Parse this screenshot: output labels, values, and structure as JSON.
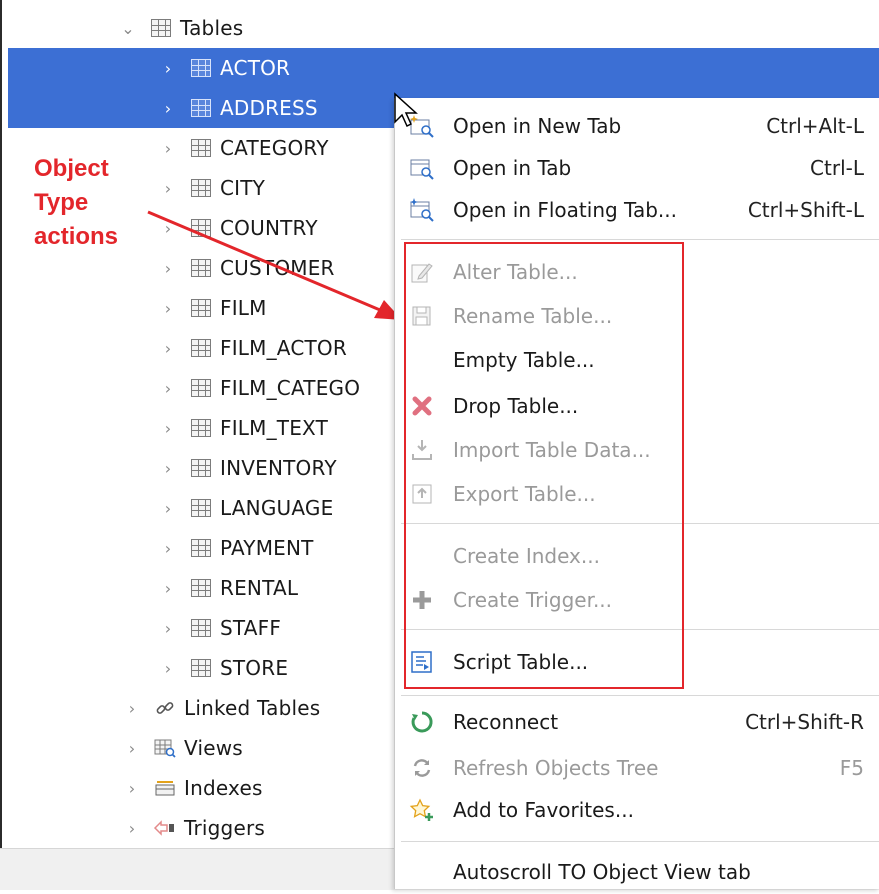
{
  "tree": {
    "tables_node": {
      "label": "Tables",
      "expander": "expanded",
      "icon": "table-icon"
    },
    "tables": [
      {
        "label": "ACTOR",
        "selected": true
      },
      {
        "label": "ADDRESS",
        "selected": true
      },
      {
        "label": "CATEGORY",
        "selected": false
      },
      {
        "label": "CITY",
        "selected": false
      },
      {
        "label": "COUNTRY",
        "selected": false
      },
      {
        "label": "CUSTOMER",
        "selected": false
      },
      {
        "label": "FILM",
        "selected": false
      },
      {
        "label": "FILM_ACTOR",
        "selected": false
      },
      {
        "label": "FILM_CATEGO",
        "selected": false
      },
      {
        "label": "FILM_TEXT",
        "selected": false
      },
      {
        "label": "INVENTORY",
        "selected": false
      },
      {
        "label": "LANGUAGE",
        "selected": false
      },
      {
        "label": "PAYMENT",
        "selected": false
      },
      {
        "label": "RENTAL",
        "selected": false
      },
      {
        "label": "STAFF",
        "selected": false
      },
      {
        "label": "STORE",
        "selected": false
      }
    ],
    "other_nodes": [
      {
        "label": "Linked Tables",
        "icon": "link-icon"
      },
      {
        "label": "Views",
        "icon": "view-icon"
      },
      {
        "label": "Indexes",
        "icon": "index-icon"
      },
      {
        "label": "Triggers",
        "icon": "trigger-icon"
      }
    ]
  },
  "annotation": {
    "line1": "Object",
    "line2": "Type",
    "line3": "actions",
    "color": "#e3262b"
  },
  "context_menu": {
    "items": [
      {
        "label": "Open in New Tab",
        "shortcut": "Ctrl+Alt-L",
        "icon": "open-new-tab-icon",
        "enabled": true
      },
      {
        "label": "Open in Tab",
        "shortcut": "Ctrl-L",
        "icon": "open-tab-icon",
        "enabled": true
      },
      {
        "label": "Open in Floating Tab...",
        "shortcut": "Ctrl+Shift-L",
        "icon": "open-floating-tab-icon",
        "enabled": true
      },
      {
        "label": "Alter Table...",
        "shortcut": "",
        "icon": "edit-icon",
        "enabled": false
      },
      {
        "label": "Rename Table...",
        "shortcut": "",
        "icon": "rename-icon",
        "enabled": false
      },
      {
        "label": "Empty Table...",
        "shortcut": "",
        "icon": "",
        "enabled": true
      },
      {
        "label": "Drop Table...",
        "shortcut": "",
        "icon": "drop-x-icon",
        "enabled": true
      },
      {
        "label": "Import Table Data...",
        "shortcut": "",
        "icon": "import-icon",
        "enabled": false
      },
      {
        "label": "Export Table...",
        "shortcut": "",
        "icon": "export-icon",
        "enabled": false
      },
      {
        "label": "Create Index...",
        "shortcut": "",
        "icon": "",
        "enabled": false
      },
      {
        "label": "Create Trigger...",
        "shortcut": "",
        "icon": "plus-icon",
        "enabled": false
      },
      {
        "label": "Script Table...",
        "shortcut": "",
        "icon": "script-icon",
        "enabled": true
      },
      {
        "label": "Reconnect",
        "shortcut": "Ctrl+Shift-R",
        "icon": "reconnect-icon",
        "enabled": true
      },
      {
        "label": "Refresh Objects Tree",
        "shortcut": "F5",
        "icon": "refresh-icon",
        "enabled": false
      },
      {
        "label": "Add to Favorites...",
        "shortcut": "",
        "icon": "star-add-icon",
        "enabled": true
      },
      {
        "label": "Autoscroll TO Object View tab",
        "shortcut": "",
        "icon": "",
        "enabled": true
      }
    ]
  },
  "colors": {
    "selection": "#3c6fd4",
    "annotation_red": "#e3262b",
    "disabled_text": "#9a9a9a"
  }
}
